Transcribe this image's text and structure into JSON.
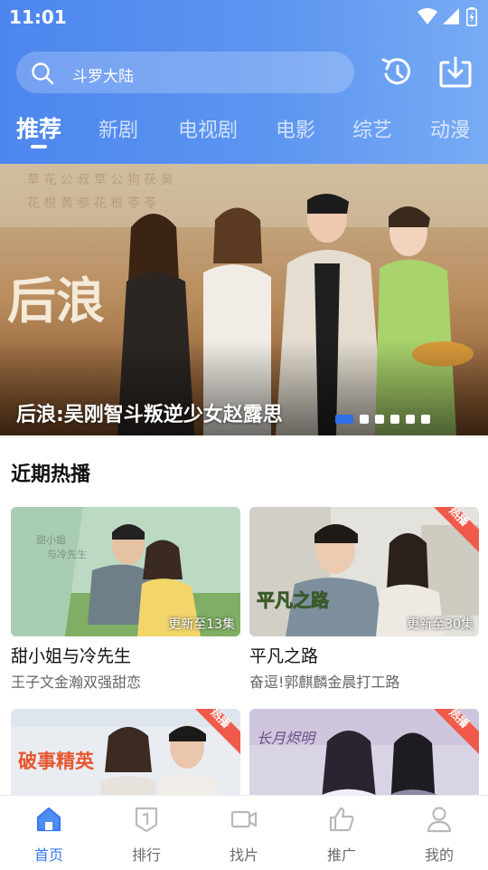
{
  "status_bar": {
    "time": "11:01"
  },
  "search": {
    "text": "斗罗大陆"
  },
  "header_icons": {
    "history": "history-icon",
    "download": "download-icon"
  },
  "tabs": [
    {
      "label": "推荐",
      "active": true
    },
    {
      "label": "新剧"
    },
    {
      "label": "电视剧"
    },
    {
      "label": "电影"
    },
    {
      "label": "综艺"
    },
    {
      "label": "动漫"
    }
  ],
  "banner": {
    "title": "后浪:吴刚智斗叛逆少女赵露思",
    "poster_text": "后浪",
    "page_count": 6,
    "active_index": 0,
    "accent": "#2f6fe8"
  },
  "section": {
    "title": "近期热播"
  },
  "cards": [
    {
      "title": "甜小姐与冷先生",
      "subtitle": "王子文金瀚双强甜恋",
      "episode": "更新至13集"
    },
    {
      "title": "平凡之路",
      "subtitle": "奋逗!郭麒麟金晨打工路",
      "episode": "更新至30集",
      "badge": "热播",
      "poster_text": "平凡之路"
    },
    {
      "badge": "热播",
      "poster_text": "破事精英"
    },
    {
      "badge": "热播",
      "poster_text": "长月烬明"
    }
  ],
  "bottom_nav": [
    {
      "label": "首页",
      "icon": "home-icon",
      "active": true
    },
    {
      "label": "排行",
      "icon": "ranking-icon"
    },
    {
      "label": "找片",
      "icon": "video-camera-icon"
    },
    {
      "label": "推广",
      "icon": "thumbs-up-icon"
    },
    {
      "label": "我的",
      "icon": "user-icon"
    }
  ],
  "colors": {
    "header": "#4d86ee",
    "accent": "#3a79ee",
    "badge": "#ef5a4a"
  }
}
